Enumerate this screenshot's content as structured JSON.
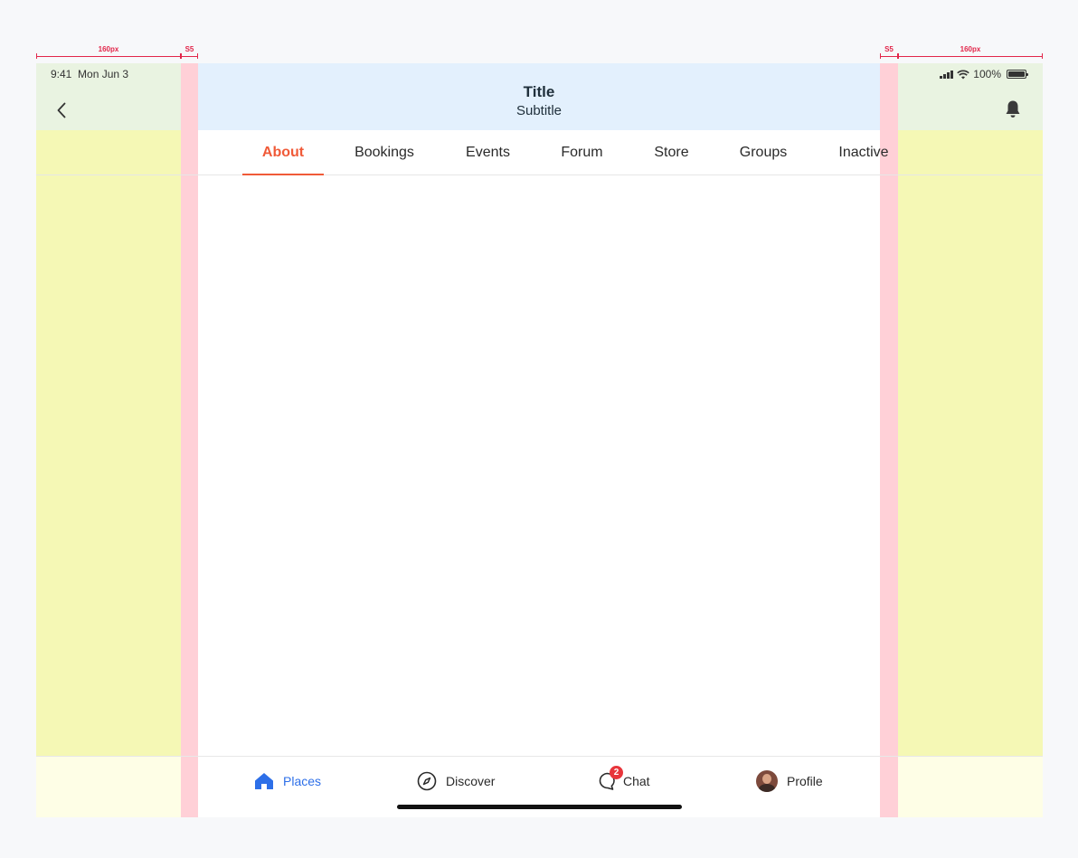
{
  "guides": {
    "left_width_label": "160px",
    "left_margin_label": "S5",
    "right_margin_label": "S5",
    "right_width_label": "160px"
  },
  "status_bar": {
    "time": "9:41",
    "date": "Mon Jun 3",
    "battery": "100%",
    "battery_level": 1.0
  },
  "header": {
    "title": "Title",
    "subtitle": "Subtitle"
  },
  "tabs": [
    {
      "label": "About",
      "active": true
    },
    {
      "label": "Bookings",
      "active": false
    },
    {
      "label": "Events",
      "active": false
    },
    {
      "label": "Forum",
      "active": false
    },
    {
      "label": "Store",
      "active": false
    },
    {
      "label": "Groups",
      "active": false
    },
    {
      "label": "Inactive",
      "active": false
    }
  ],
  "bottom_nav": [
    {
      "label": "Places",
      "icon": "home-icon",
      "active": true
    },
    {
      "label": "Discover",
      "icon": "compass-icon",
      "active": false
    },
    {
      "label": "Chat",
      "icon": "chat-icon",
      "active": false,
      "badge": "2"
    },
    {
      "label": "Profile",
      "icon": "avatar",
      "active": false
    }
  ],
  "colors": {
    "accent": "#f05a38",
    "primary": "#2d6fe8",
    "badge": "#e8353b"
  }
}
